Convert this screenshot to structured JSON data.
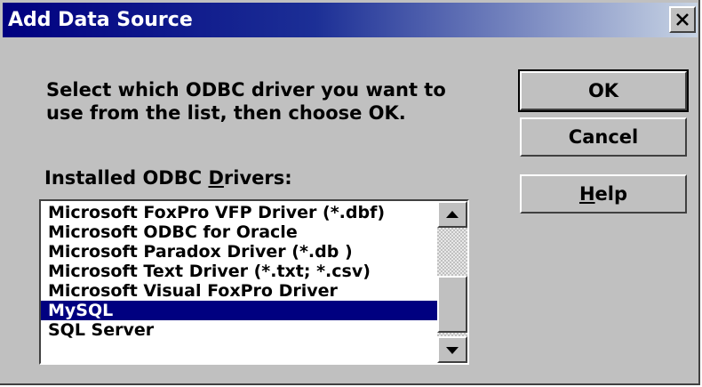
{
  "window": {
    "title": "Add Data Source",
    "close_icon": "close-icon"
  },
  "instructions": "Select which ODBC driver you want to\nuse from the list, then choose OK.",
  "list_label": {
    "before": "Installed ODBC ",
    "accel": "D",
    "after": "rivers:"
  },
  "drivers": [
    "Microsoft FoxPro VFP Driver (*.dbf)",
    "Microsoft ODBC for Oracle",
    "Microsoft Paradox Driver (*.db )",
    "Microsoft Text Driver (*.txt; *.csv)",
    "Microsoft Visual FoxPro Driver",
    "MySQL",
    "SQL Server"
  ],
  "selected_driver": "MySQL",
  "buttons": {
    "ok": "OK",
    "cancel": "Cancel",
    "help_accel": "H",
    "help_rest": "elp"
  },
  "colors": {
    "selection": "#000080",
    "title_bar": "#000080",
    "face": "#c0c0c0"
  }
}
